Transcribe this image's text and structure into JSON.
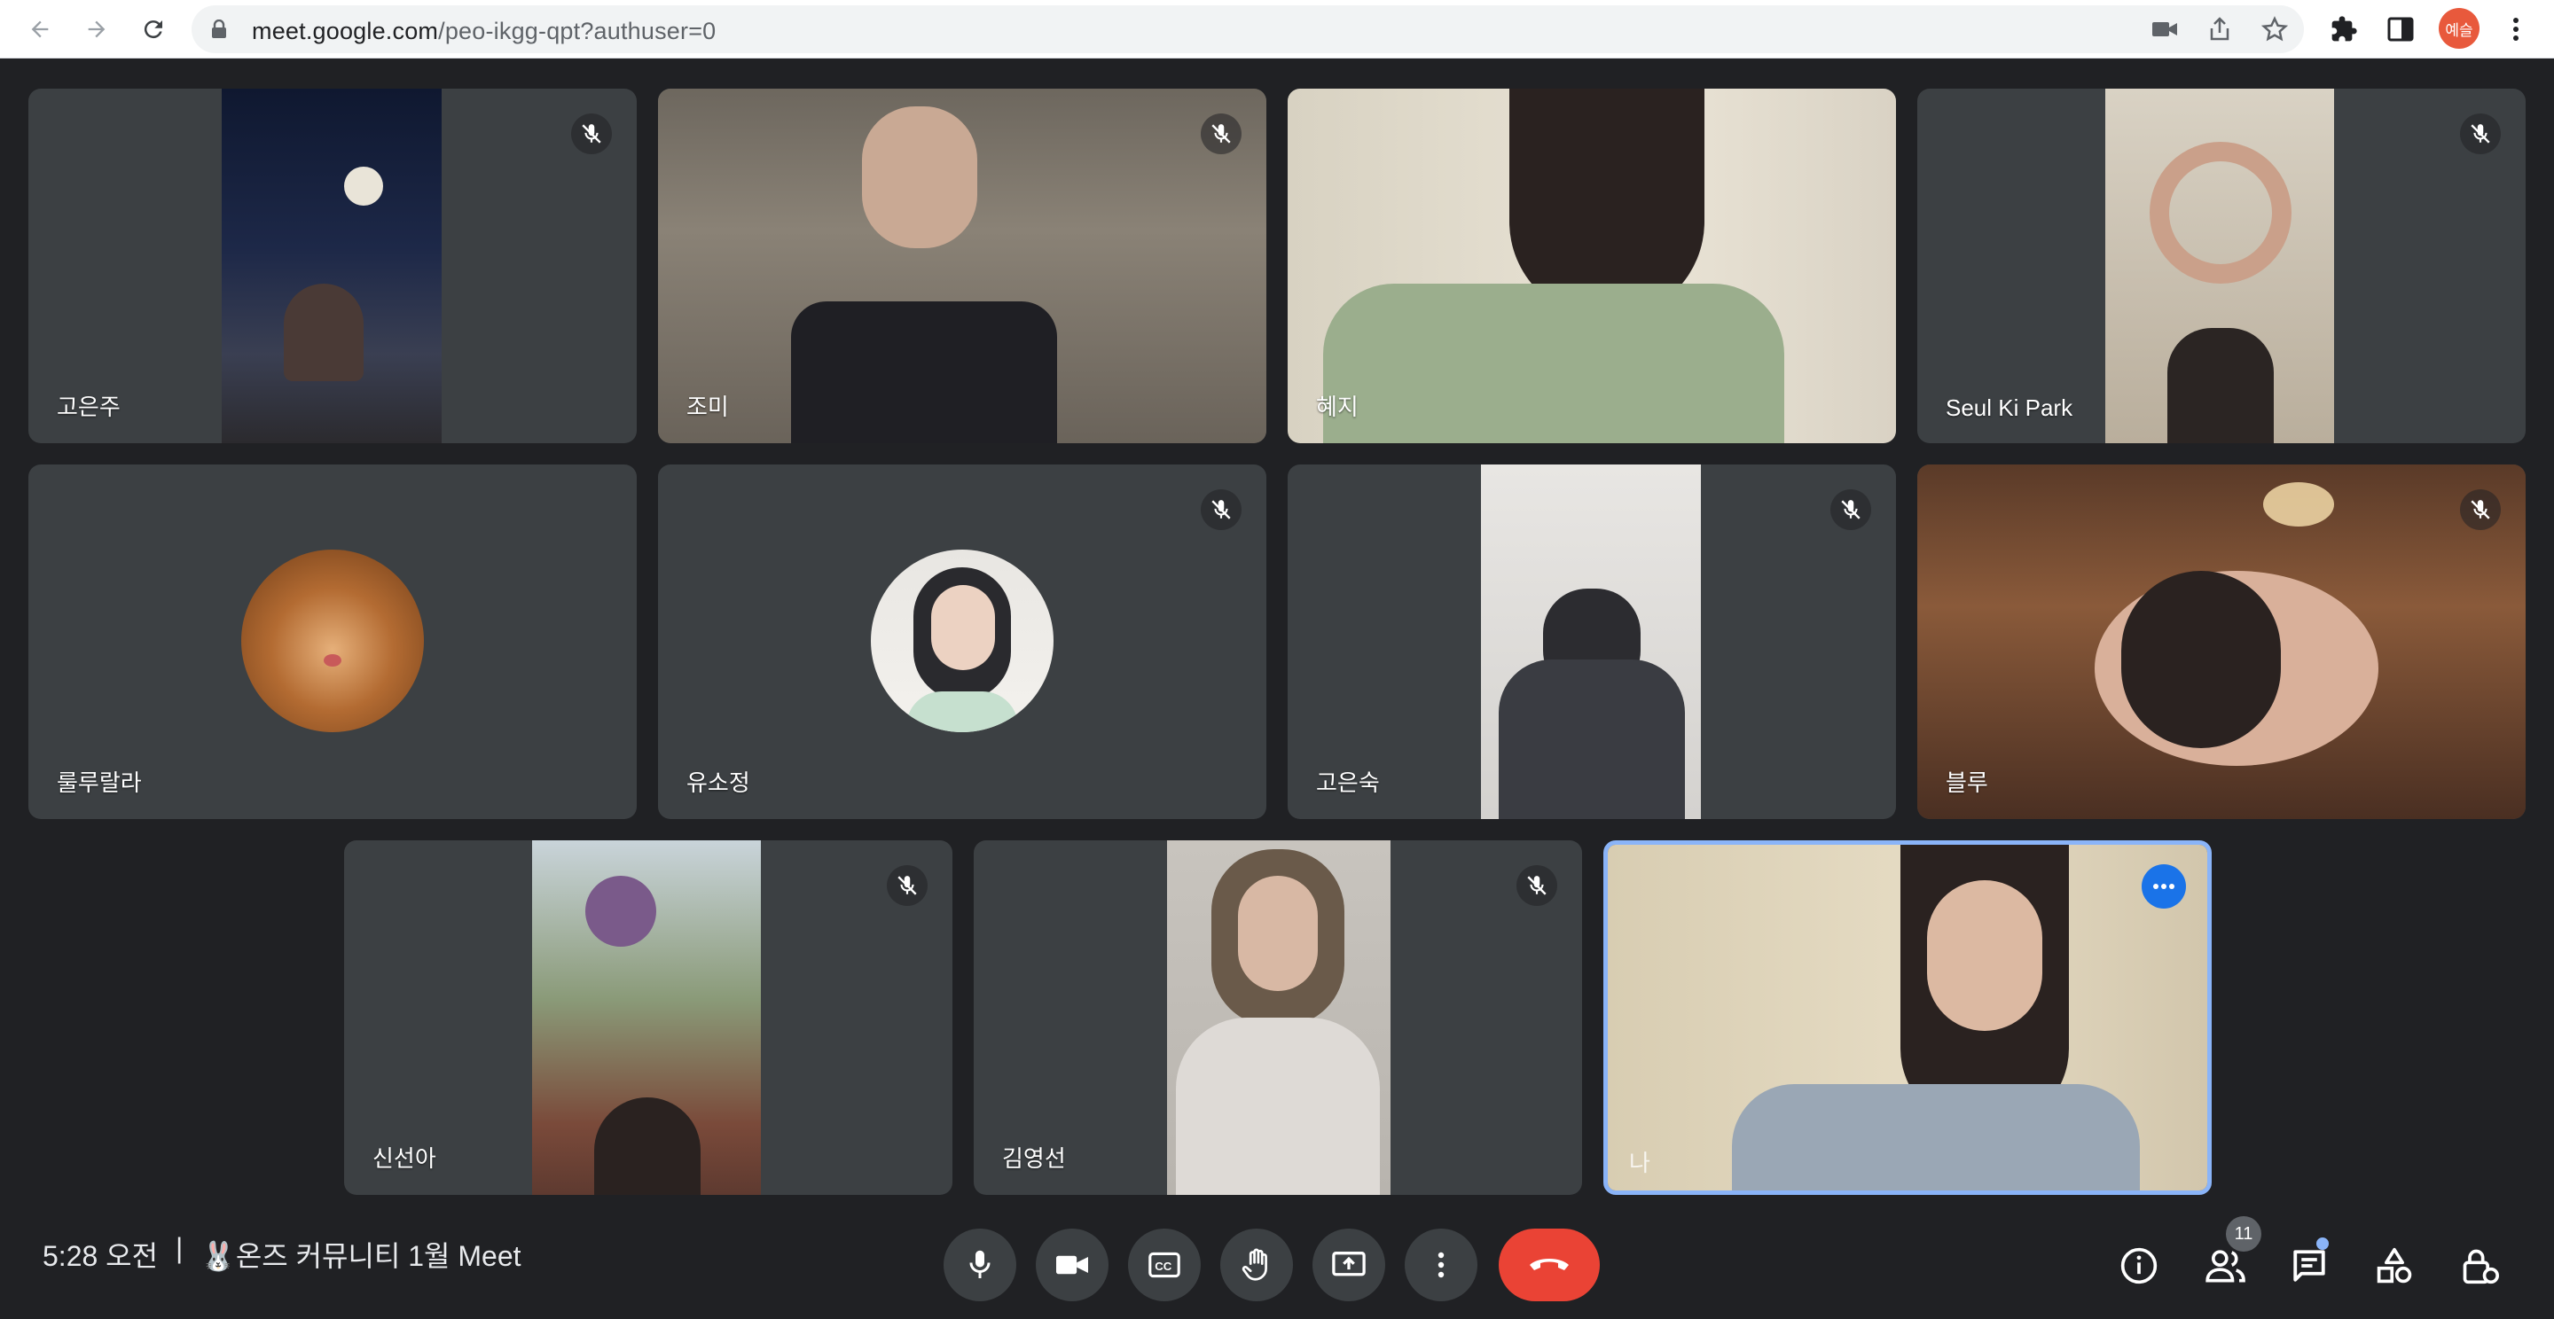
{
  "browser": {
    "url_host": "meet.google.com",
    "url_path": "/peo-ikgg-qpt?authuser=0",
    "profile_initials": "예슬"
  },
  "participants": [
    {
      "name": "고은주",
      "muted": true
    },
    {
      "name": "조미",
      "muted": true
    },
    {
      "name": "혜지",
      "muted": false
    },
    {
      "name": "Seul Ki Park",
      "muted": true
    },
    {
      "name": "룰루랄라",
      "muted": false
    },
    {
      "name": "유소정",
      "muted": true
    },
    {
      "name": "고은숙",
      "muted": true
    },
    {
      "name": "블루",
      "muted": true
    },
    {
      "name": "신선아",
      "muted": true
    },
    {
      "name": "김영선",
      "muted": true
    }
  ],
  "self_tile": {
    "label": "나"
  },
  "bottom": {
    "time": "5:28 오전",
    "separator": "|",
    "meeting_title": "🐰온즈 커뮤니티 1월 Meet",
    "participant_count": "11"
  },
  "colors": {
    "stage_bg": "#202124",
    "tile_bg": "#3c4043",
    "end_call": "#ea4335",
    "self_border": "#8ab4f8",
    "accent_blue": "#1a73e8"
  }
}
